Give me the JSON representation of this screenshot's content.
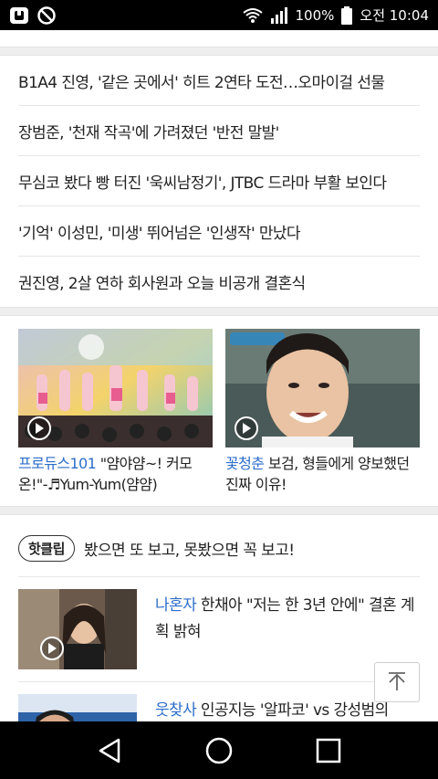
{
  "status_bar": {
    "battery_percent": "100%",
    "time": "오전 10:04",
    "icons": [
      "app-icon",
      "blocked-icon",
      "wifi-icon",
      "signal-icon",
      "battery-icon"
    ]
  },
  "news": [
    "B1A4 진영, '같은 곳에서' 히트 2연타 도전…오마이걸 선물",
    "장범준, '천재 작곡'에 가려졌던 '반전 말발'",
    "무심코 봤다 빵 터진 '욱씨남정기', JTBC 드라마 부활 보인다",
    "'기억' 이성민, '미생' 뛰어넘은 '인생작' 만났다",
    "권진영, 2살 연하 회사원과 오늘 비공개 결혼식"
  ],
  "videos": [
    {
      "tag": "프로듀스101",
      "title": " \"얌야얌~! 커모온!\"-♬Yum-Yum(얌얌)"
    },
    {
      "tag": "꽃청춘",
      "title": " 보검, 형들에게 양보했던 진짜 이유!"
    }
  ],
  "hotclip": {
    "badge": "핫클립",
    "title": "봤으면 또 보고, 못봤으면 꼭 보고!"
  },
  "clips": [
    {
      "tag": "나혼자",
      "title": " 한채아 \"저는 한 3년 안에\" 결혼 계획 밝혀"
    },
    {
      "tag": "웃찾사",
      "title": " 인공지능 '알파코' vs 강성범의"
    }
  ],
  "colors": {
    "accent": "#2d6ec9",
    "separator": "#eeeeee"
  }
}
